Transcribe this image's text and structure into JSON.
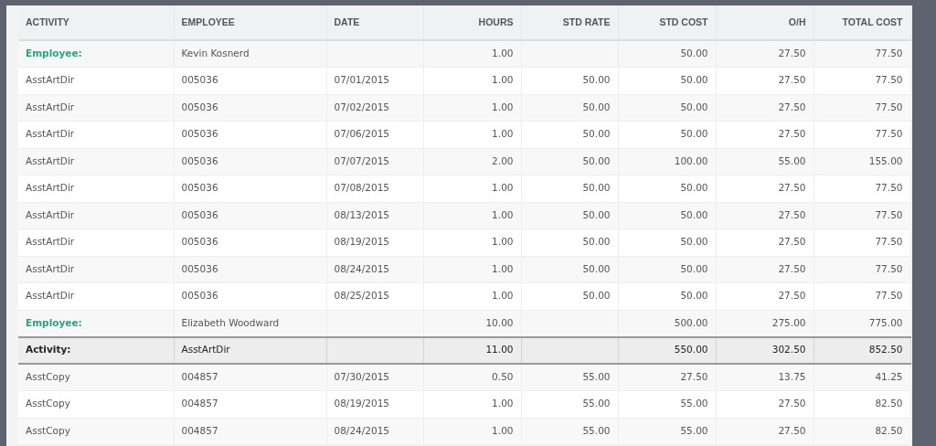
{
  "table": {
    "columns": [
      "ACTIVITY",
      "EMPLOYEE",
      "DATE",
      "HOURS",
      "STD RATE",
      "STD COST",
      "O/H",
      "TOTAL COST"
    ],
    "rows": [
      {
        "kind": "employee",
        "cells": [
          "Employee:",
          "Kevin Kosnerd",
          "",
          "1.00",
          "",
          "50.00",
          "27.50",
          "77.50"
        ]
      },
      {
        "kind": "detail",
        "cells": [
          "AsstArtDir",
          "005036",
          "07/01/2015",
          "1.00",
          "50.00",
          "50.00",
          "27.50",
          "77.50"
        ]
      },
      {
        "kind": "detail",
        "cells": [
          "AsstArtDir",
          "005036",
          "07/02/2015",
          "1.00",
          "50.00",
          "50.00",
          "27.50",
          "77.50"
        ]
      },
      {
        "kind": "detail",
        "cells": [
          "AsstArtDir",
          "005036",
          "07/06/2015",
          "1.00",
          "50.00",
          "50.00",
          "27.50",
          "77.50"
        ]
      },
      {
        "kind": "detail",
        "cells": [
          "AsstArtDir",
          "005036",
          "07/07/2015",
          "2.00",
          "50.00",
          "100.00",
          "55.00",
          "155.00"
        ]
      },
      {
        "kind": "detail",
        "cells": [
          "AsstArtDir",
          "005036",
          "07/08/2015",
          "1.00",
          "50.00",
          "50.00",
          "27.50",
          "77.50"
        ]
      },
      {
        "kind": "detail",
        "cells": [
          "AsstArtDir",
          "005036",
          "08/13/2015",
          "1.00",
          "50.00",
          "50.00",
          "27.50",
          "77.50"
        ]
      },
      {
        "kind": "detail",
        "cells": [
          "AsstArtDir",
          "005036",
          "08/19/2015",
          "1.00",
          "50.00",
          "50.00",
          "27.50",
          "77.50"
        ]
      },
      {
        "kind": "detail",
        "cells": [
          "AsstArtDir",
          "005036",
          "08/24/2015",
          "1.00",
          "50.00",
          "50.00",
          "27.50",
          "77.50"
        ]
      },
      {
        "kind": "detail",
        "cells": [
          "AsstArtDir",
          "005036",
          "08/25/2015",
          "1.00",
          "50.00",
          "50.00",
          "27.50",
          "77.50"
        ]
      },
      {
        "kind": "employee",
        "cells": [
          "Employee:",
          "Elizabeth Woodward",
          "",
          "10.00",
          "",
          "500.00",
          "275.00",
          "775.00"
        ]
      },
      {
        "kind": "activity",
        "cells": [
          "Activity:",
          "AsstArtDir",
          "",
          "11.00",
          "",
          "550.00",
          "302.50",
          "852.50"
        ]
      },
      {
        "kind": "detail",
        "cells": [
          "AsstCopy",
          "004857",
          "07/30/2015",
          "0.50",
          "55.00",
          "27.50",
          "13.75",
          "41.25"
        ]
      },
      {
        "kind": "detail",
        "cells": [
          "AsstCopy",
          "004857",
          "08/19/2015",
          "1.00",
          "55.00",
          "55.00",
          "27.50",
          "82.50"
        ]
      },
      {
        "kind": "detail",
        "cells": [
          "AsstCopy",
          "004857",
          "08/24/2015",
          "1.00",
          "55.00",
          "55.00",
          "27.50",
          "82.50"
        ]
      }
    ]
  }
}
